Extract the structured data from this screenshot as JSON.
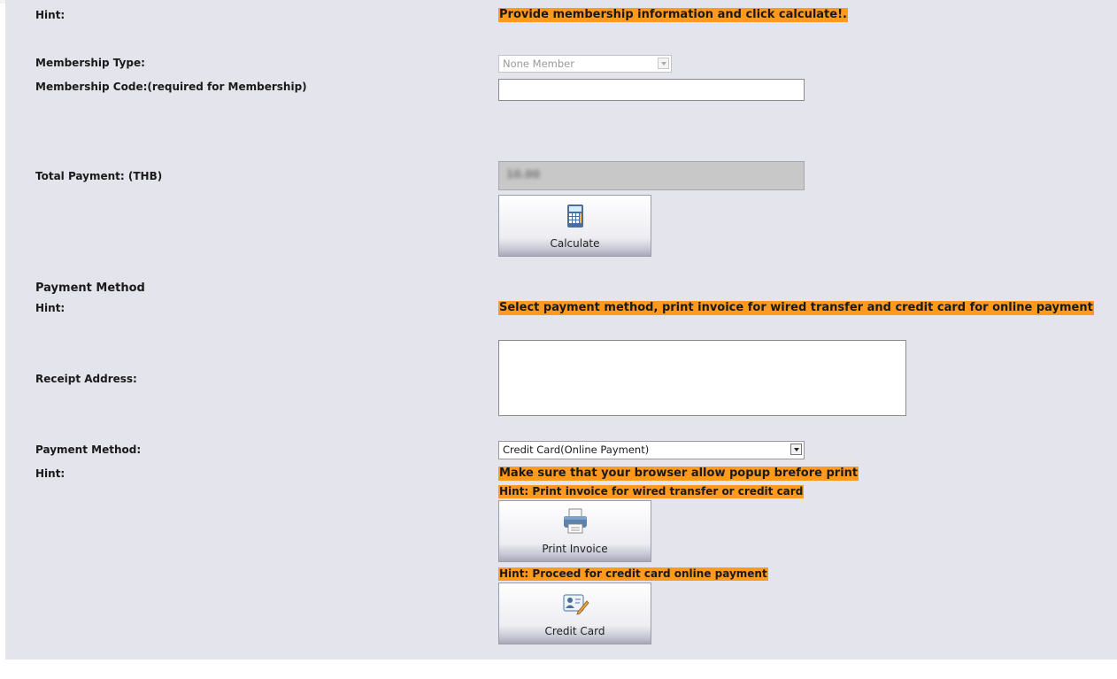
{
  "form": {
    "hint_label": "Hint:",
    "hint_top": "Provide membership information and click calculate!.",
    "membership_type_label": "Membership Type:",
    "membership_type_value": "None Member",
    "membership_code_label": "Membership Code:(required for Membership)",
    "membership_code_value": "",
    "total_payment_label": "Total Payment: (THB)",
    "total_payment_value": "10.00",
    "calculate_label": "Calculate",
    "payment_method_section": "Payment Method",
    "hint_payment": "Select payment method, print invoice for wired transfer and credit card for online payment",
    "receipt_address_label": "Receipt Address:",
    "receipt_address_value": "",
    "payment_method_label": "Payment Method:",
    "payment_method_value": "Credit Card(Online Payment)",
    "hint_popup": "Make sure that your browser allow popup brefore print",
    "hint_print": "Hint: Print invoice for wired transfer or credit card",
    "print_invoice_label": "Print Invoice",
    "hint_proceed": "Hint: Proceed for credit card online payment",
    "credit_card_label": "Credit Card"
  },
  "icons": {
    "calculate": "calculator-icon",
    "print": "printer-icon",
    "credit_card": "id-card-pencil-icon"
  },
  "colors": {
    "panel_background": "#e4e4ec",
    "hint_highlight": "#ff9a1f"
  }
}
